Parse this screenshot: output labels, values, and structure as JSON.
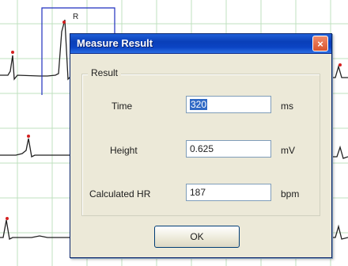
{
  "background": {
    "marker_label": "R"
  },
  "dialog": {
    "title": "Measure Result",
    "close_glyph": "×",
    "group_label": "Result",
    "rows": [
      {
        "label": "Time",
        "value": "320",
        "unit": "ms"
      },
      {
        "label": "Height",
        "value": "0.625",
        "unit": "mV"
      },
      {
        "label": "Calculated HR",
        "value": "187",
        "unit": "bpm"
      }
    ],
    "ok_label": "OK"
  },
  "colors": {
    "grid": "#bfe0bf",
    "trace": "#222222",
    "marker": "#d42020",
    "measure_box": "#1f2fbf",
    "dialog_bg": "#ece9d8",
    "title_bar": "#0b44c4",
    "selection": "#316ac5"
  }
}
